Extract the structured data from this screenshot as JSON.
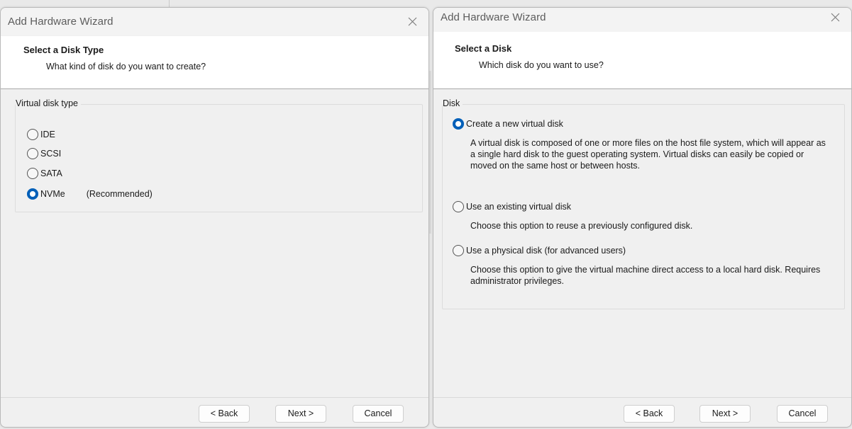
{
  "wizard_left": {
    "window_title": "Add Hardware Wizard",
    "header": {
      "title": "Select a Disk Type",
      "subtitle": "What kind of disk do you want to create?"
    },
    "group_label": "Virtual disk type",
    "options": [
      {
        "label": "IDE",
        "selected": false
      },
      {
        "label": "SCSI",
        "selected": false
      },
      {
        "label": "SATA",
        "selected": false
      },
      {
        "label": "NVMe",
        "selected": true,
        "note": "(Recommended)"
      }
    ],
    "buttons": {
      "back": "< Back",
      "next": "Next >",
      "cancel": "Cancel"
    }
  },
  "wizard_right": {
    "window_title": "Add Hardware Wizard",
    "header": {
      "title": "Select a Disk",
      "subtitle": "Which disk do you want to use?"
    },
    "group_label": "Disk",
    "options": [
      {
        "label": "Create a new virtual disk",
        "selected": true,
        "description": "A virtual disk is composed of one or more files on the host file system, which will appear as a single hard disk to the guest operating system. Virtual disks can easily be copied or moved on the same host or between hosts."
      },
      {
        "label": "Use an existing virtual disk",
        "selected": false,
        "description": "Choose this option to reuse a previously configured disk."
      },
      {
        "label": "Use a physical disk (for advanced users)",
        "selected": false,
        "description": "Choose this option to give the virtual machine direct access to a local hard disk. Requires administrator privileges."
      }
    ],
    "buttons": {
      "back": "< Back",
      "next": "Next >",
      "cancel": "Cancel"
    }
  },
  "colors": {
    "accent": "#005fb8",
    "window_bg": "#f0f0f0",
    "header_bg": "#ffffff"
  },
  "icons": {
    "close": "close-icon"
  }
}
